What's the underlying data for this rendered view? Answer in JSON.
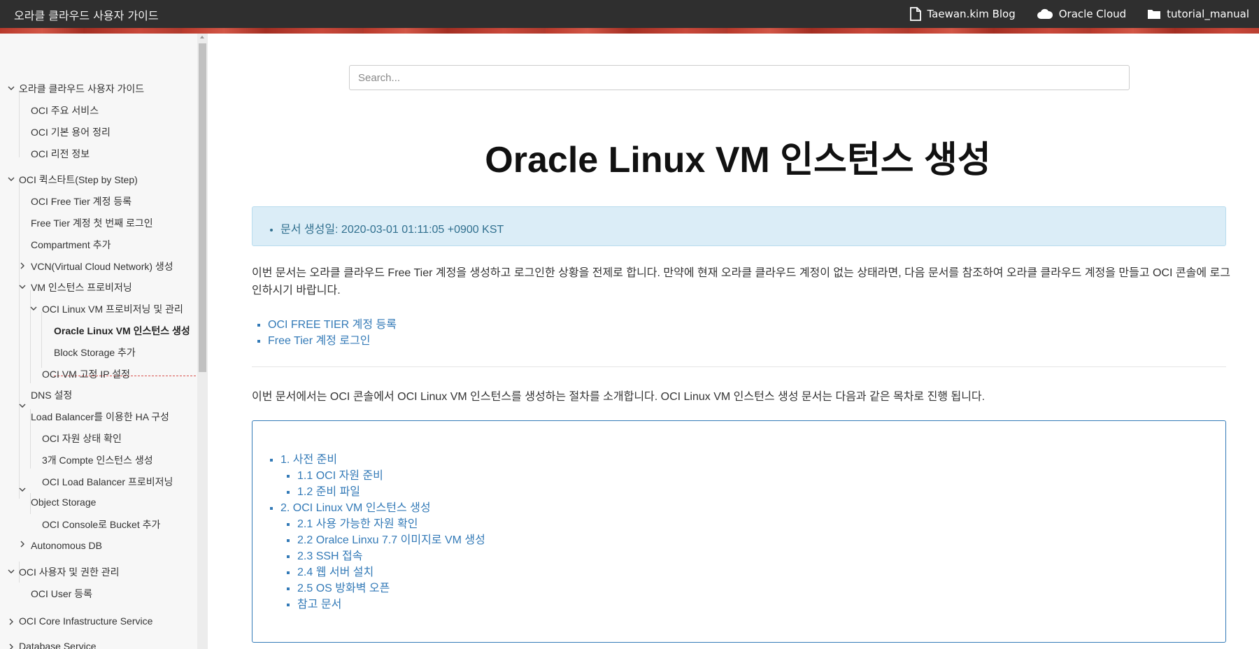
{
  "header": {
    "site_title": "오라클 클라우드 사용자 가이드",
    "nav": [
      {
        "label": "Taewan.kim Blog",
        "icon": "file-icon"
      },
      {
        "label": "Oracle Cloud",
        "icon": "cloud-icon"
      },
      {
        "label": "tutorial_manual",
        "icon": "folder-icon"
      }
    ]
  },
  "sidebar": {
    "items": [
      {
        "label": "오라클 클라우드 사용자 가이드",
        "state": "expanded"
      },
      {
        "label": "OCI 주요 서비스"
      },
      {
        "label": "OCI 기본 용어 정리"
      },
      {
        "label": "OCI 리전 정보"
      },
      {
        "label": "OCI 퀵스타트(Step by Step)",
        "state": "expanded"
      },
      {
        "label": "OCI Free Tier 계정 등록"
      },
      {
        "label": "Free Tier 계정 첫 번째 로그인"
      },
      {
        "label": "Compartment 추가"
      },
      {
        "label": "VCN(Virtual Cloud Network) 생성",
        "state": "collapsed"
      },
      {
        "label": "VM 인스턴스 프로비저닝",
        "state": "expanded"
      },
      {
        "label": "OCI Linux VM 프로비저닝 및 관리",
        "state": "expanded"
      },
      {
        "label": "Oracle Linux VM 인스턴스 생성",
        "state": "active"
      },
      {
        "label": "Block Storage 추가"
      },
      {
        "label": "OCI VM 고정 IP 설정"
      },
      {
        "label": "DNS 설정"
      },
      {
        "label": "Load Balancer를 이용한 HA 구성",
        "state": "expanded"
      },
      {
        "label": "OCI 자원 상태 확인"
      },
      {
        "label": "3개 Compte 인스턴스 생성"
      },
      {
        "label": "OCI Load Balancer 프로비저닝"
      },
      {
        "label": "Object Storage",
        "state": "expanded"
      },
      {
        "label": "OCI Console로 Bucket 추가"
      },
      {
        "label": "Autonomous DB",
        "state": "collapsed"
      },
      {
        "label": "OCI 사용자 및 권한 관리",
        "state": "expanded"
      },
      {
        "label": "OCI User 등록"
      },
      {
        "label": "OCI Core Infastructure Service",
        "state": "collapsed"
      },
      {
        "label": "Database Service",
        "state": "collapsed"
      }
    ]
  },
  "main": {
    "search_placeholder": "Search...",
    "title": "Oracle Linux VM 인스턴스 생성",
    "info": "문서 생성일: 2020-03-01 01:11:05 +0900 KST",
    "intro": "이번 문서는 오라클 클라우드 Free Tier 계정을 생성하고 로그인한 상황을 전제로 합니다. 만약에 현재 오라클 클라우드 계정이 없는 상태라면, 다음 문서를 참조하여 오라클 클라우드 계정을 만들고 OCI 콘솔에 로그인하시기 바랍니다.",
    "links": [
      "OCI FREE TIER 계정 등록",
      "Free Tier 계정 로그인"
    ],
    "para2": "이번 문서에서는 OCI 콘솔에서 OCI Linux VM 인스턴스를 생성하는 절차를 소개합니다. OCI Linux VM 인스턴스 생성 문서는 다음과 같은 목차로 진행 됩니다.",
    "toc": [
      {
        "label": "1. 사전 준비",
        "children": [
          "1.1 OCI 자원 준비",
          "1.2 준비 파일"
        ]
      },
      {
        "label": "2. OCI Linux VM 인스턴스 생성",
        "children": [
          "2.1 사용 가능한 자원 확인",
          "2.2 Oralce Linxu 7.7 이미지로 VM 생성",
          "2.3 SSH 접속",
          "2.4 웹 서버 설치",
          "2.5 OS 방화벽 오픈",
          "참고 문서"
        ]
      }
    ]
  },
  "colors": {
    "topbar": "#2f2f2f",
    "link": "#337ab7",
    "info_bg": "#dbedf7",
    "active_underline": "#d9534f"
  }
}
